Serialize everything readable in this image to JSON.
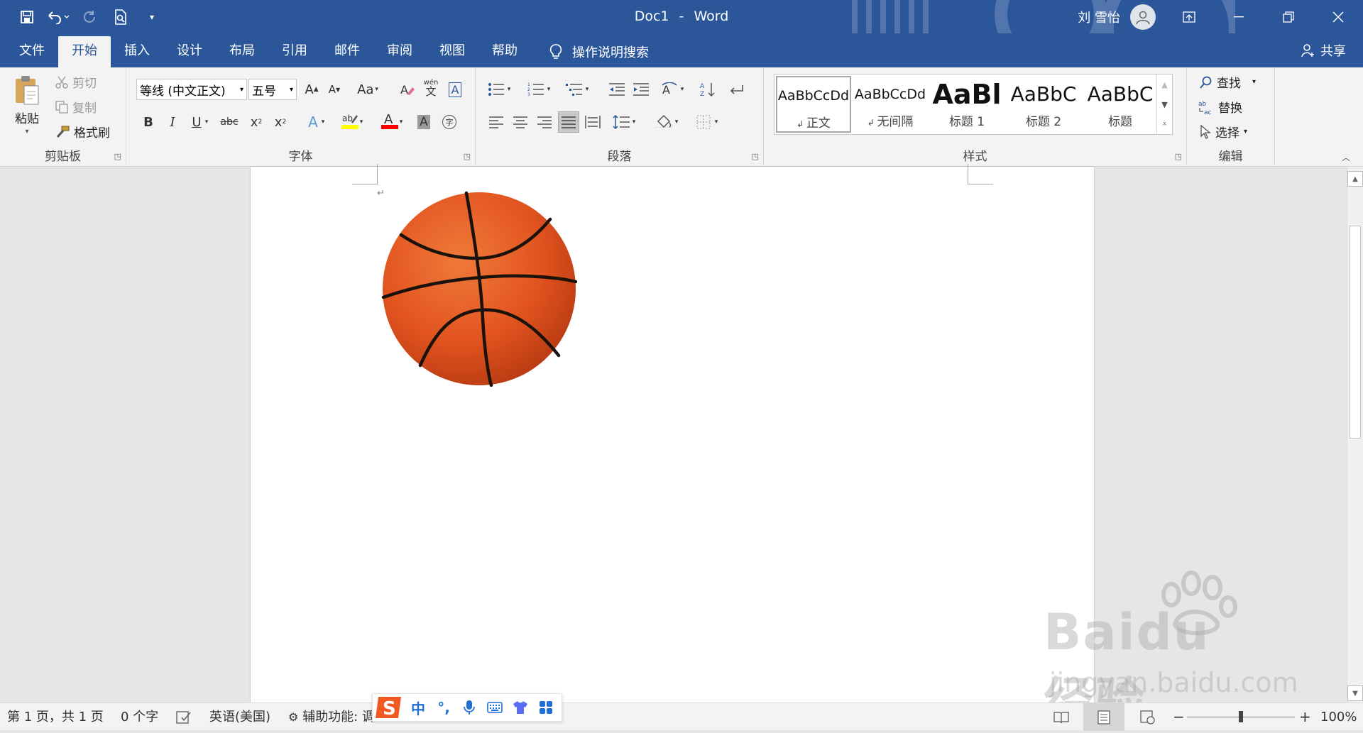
{
  "app": {
    "doc_name": "Doc1",
    "separator": "-",
    "app_name": "Word"
  },
  "user": {
    "name": "刘 雪怡"
  },
  "tabs": [
    "文件",
    "开始",
    "插入",
    "设计",
    "布局",
    "引用",
    "邮件",
    "审阅",
    "视图",
    "帮助"
  ],
  "active_tab": "开始",
  "tell_me": "操作说明搜索",
  "share": "共享",
  "clipboard": {
    "paste": "粘贴",
    "cut": "剪切",
    "copy": "复制",
    "format_painter": "格式刷",
    "label": "剪贴板"
  },
  "font": {
    "name": "等线 (中文正文)",
    "size": "五号",
    "case_label": "Aa",
    "phonetic_top": "wén",
    "phonetic_bottom": "文",
    "label": "字体"
  },
  "paragraph": {
    "label": "段落"
  },
  "styles": {
    "label": "样式",
    "items": [
      {
        "sample": "AaBbCcDd",
        "name": "正文",
        "selected": true
      },
      {
        "sample": "AaBbCcDd",
        "name": "无间隔",
        "selected": false
      },
      {
        "sample": "AaBl",
        "name": "标题 1",
        "selected": false
      },
      {
        "sample": "AaBbC",
        "name": "标题 2",
        "selected": false
      },
      {
        "sample": "AaBbC",
        "name": "标题",
        "selected": false
      }
    ]
  },
  "editing": {
    "find": "查找",
    "replace": "替换",
    "select": "选择",
    "label": "编辑"
  },
  "document": {
    "paragraph_mark": "↵",
    "image": "basketball-image"
  },
  "status": {
    "page": "第 1 页，共 1 页",
    "words": "0 个字",
    "language": "英语(美国)",
    "accessibility": "辅助功能: 调",
    "zoom": "100%",
    "zoom_level": 1.0
  },
  "ime": {
    "mode": "中",
    "punct": "°,"
  },
  "watermark": {
    "brand": "Baidu经验",
    "url": "jingyan.baidu.com"
  },
  "colors": {
    "brand": "#2b579a",
    "highlight": "#ffff00",
    "font_color": "#ff0000",
    "ime_logo": "#f05a22"
  }
}
